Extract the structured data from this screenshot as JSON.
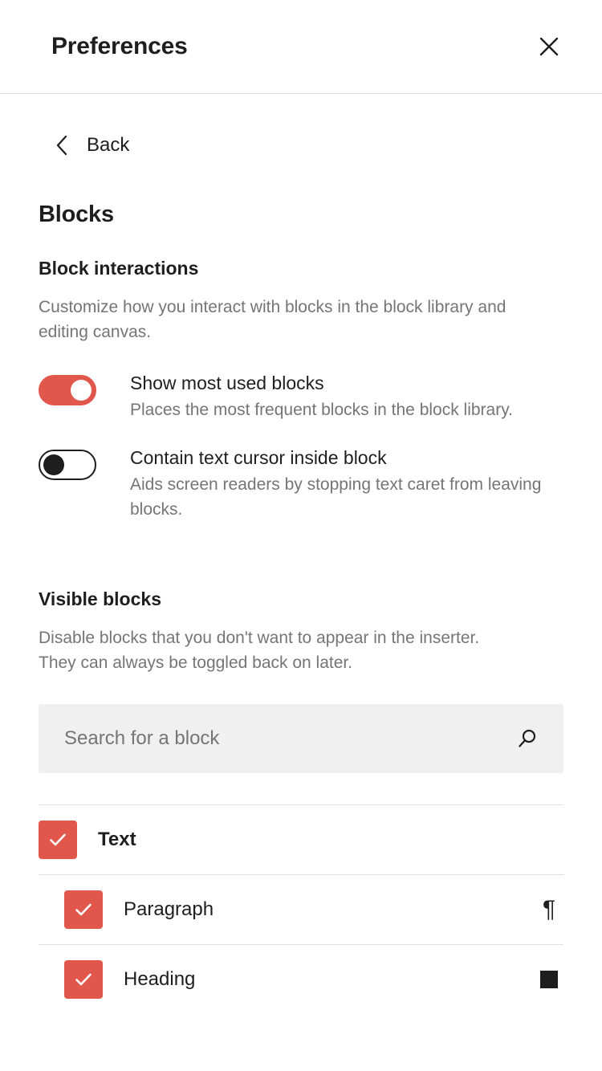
{
  "header": {
    "title": "Preferences",
    "close_icon": "close-icon"
  },
  "navigation": {
    "back_label": "Back",
    "back_icon": "chevron-left-icon"
  },
  "page": {
    "title": "Blocks"
  },
  "block_interactions": {
    "title": "Block interactions",
    "description": "Customize how you interact with blocks in the block library and editing canvas.",
    "toggles": [
      {
        "label": "Show most used blocks",
        "description": "Places the most frequent blocks in the block library.",
        "state": "on"
      },
      {
        "label": "Contain text cursor inside block",
        "description": "Aids screen readers by stopping text caret from leaving blocks.",
        "state": "off"
      }
    ]
  },
  "visible_blocks": {
    "title": "Visible blocks",
    "description": "Disable blocks that you don't want to appear in the inserter. They can always be toggled back on later.",
    "search": {
      "placeholder": "Search for a block",
      "value": "",
      "icon": "search-icon"
    },
    "rows": [
      {
        "label": "Text",
        "type": "category",
        "checked": true,
        "icon": ""
      },
      {
        "label": "Paragraph",
        "type": "child",
        "checked": true,
        "icon": "pilcrow-icon"
      },
      {
        "label": "Heading",
        "type": "child",
        "checked": true,
        "icon": "heading-icon"
      }
    ]
  },
  "colors": {
    "accent": "#e2574c",
    "text": "#1e1e1e",
    "muted": "#757575",
    "divider": "#e0e0e0",
    "field_bg": "#f0f0f0"
  }
}
